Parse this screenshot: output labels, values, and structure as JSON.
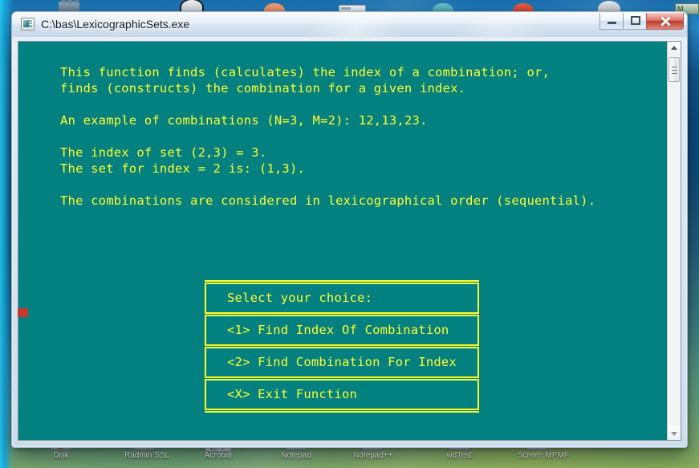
{
  "window": {
    "title": "C:\\bas\\LexicographicSets.exe",
    "app_icon": "console-app-icon",
    "controls": {
      "minimize": "Minimize",
      "maximize": "Maximize",
      "close": "Close"
    }
  },
  "console": {
    "background_color": "#038080",
    "text_color": "#ffff2e",
    "body": "This function finds (calculates) the index of a combination; or,\nfinds (constructs) the combination for a given index.\n\nAn example of combinations (N=3, M=2): 12,13,23.\n\nThe index of set (2,3) = 3.\nThe set for index = 2 is: (1,3).\n\nThe combinations are considered in lexicographical order (sequential).",
    "lines": [
      "This function finds (calculates) the index of a combination; or,",
      "finds (constructs) the combination for a given index.",
      "",
      "An example of combinations (N=3, M=2): 12,13,23.",
      "",
      "The index of set (2,3) = 3.",
      "The set for index = 2 is: (1,3).",
      "",
      "The combinations are considered in lexicographical order (sequential)."
    ]
  },
  "menu": {
    "prompt": "Select your choice:",
    "options": [
      "<1> Find Index Of Combination",
      "<2> Find Combination For Index",
      "<X> Exit Function"
    ]
  },
  "scrollbar": {
    "up_arrow": "scroll-up-arrow",
    "down_arrow": "scroll-down-arrow",
    "thumb": "scroll-thumb"
  },
  "desktop": {
    "icons_bottom": [
      "Disk",
      "Radmin SSL",
      "Acrobat",
      "Notepad",
      "Notepad++",
      "wdTest",
      "Screen MPMF"
    ],
    "wallpaper_colors": [
      "#1f7fc0",
      "#0c4a7d",
      "#8caf63"
    ]
  }
}
